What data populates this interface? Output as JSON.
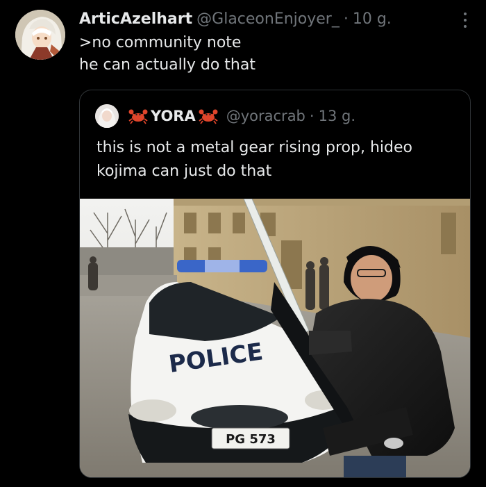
{
  "tweet": {
    "display_name": "ArticAzelhart",
    "handle": "@GlaceonEnjoyer_",
    "separator": "·",
    "time": "10 g.",
    "avatar_icon": "anime-avatar",
    "more_icon": "more-vertical-icon",
    "lines": [
      ">no community note",
      "he can actually do that"
    ]
  },
  "quote": {
    "display_name": "YORA",
    "name_emoji": "crab",
    "handle": "@yoracrab",
    "separator": "·",
    "time": "13 g.",
    "lines": [
      "this is not a metal gear rising prop, hideo",
      "kojima can just do that"
    ],
    "photo": {
      "car_text": "POLICE",
      "plate": "PG 573"
    }
  },
  "colors": {
    "background": "#000000",
    "text_primary": "#e7e9ea",
    "text_secondary": "#71767b",
    "border": "#2f3336",
    "crab": "#e0452b"
  }
}
